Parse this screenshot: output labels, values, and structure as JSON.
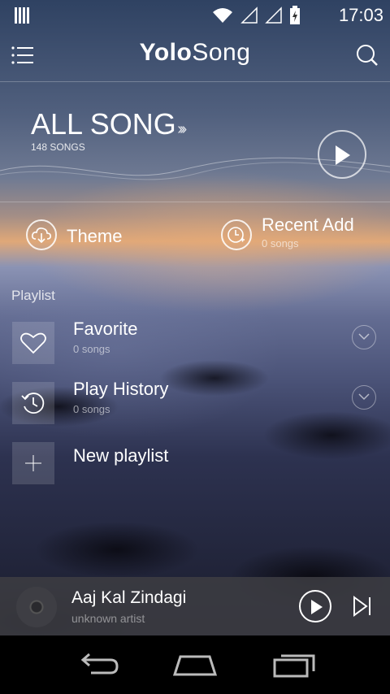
{
  "status_bar": {
    "time": "17:03"
  },
  "header": {
    "title_bold": "Yolo",
    "title_rest": "Song"
  },
  "hero": {
    "title": "ALL SONG",
    "subtitle": "148 SONGS"
  },
  "quick_actions": [
    {
      "label": "Theme",
      "icon": "cloud-download-icon"
    },
    {
      "label": "Recent Add",
      "sub": "0 songs",
      "icon": "clock-add-icon"
    }
  ],
  "playlist": {
    "heading": "Playlist",
    "items": [
      {
        "name": "Favorite",
        "sub": "0 songs",
        "icon": "heart-icon"
      },
      {
        "name": "Play History",
        "sub": "0 songs",
        "icon": "history-icon"
      },
      {
        "name": "New playlist",
        "icon": "plus-icon"
      }
    ]
  },
  "now_playing": {
    "title": "Aaj Kal Zindagi",
    "artist": "unknown artist"
  }
}
